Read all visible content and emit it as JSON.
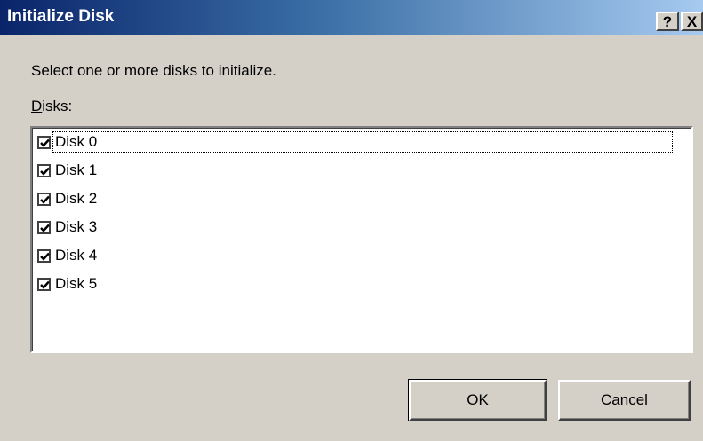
{
  "window": {
    "title": "Initialize Disk",
    "help_label": "?",
    "close_label": "X"
  },
  "instruction": "Select one or more disks to initialize.",
  "disks_label": {
    "mnemonic": "D",
    "rest": "isks:"
  },
  "disks": [
    {
      "label": "Disk 0",
      "checked": true,
      "focused": true
    },
    {
      "label": "Disk 1",
      "checked": true
    },
    {
      "label": "Disk 2",
      "checked": true
    },
    {
      "label": "Disk 3",
      "checked": true
    },
    {
      "label": "Disk 4",
      "checked": true
    },
    {
      "label": "Disk 5",
      "checked": true
    }
  ],
  "buttons": {
    "ok": "OK",
    "cancel": "Cancel"
  }
}
